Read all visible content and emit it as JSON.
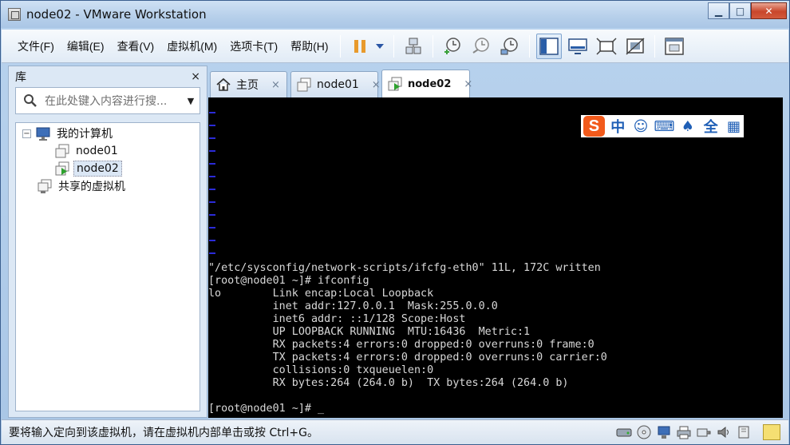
{
  "window": {
    "title": "node02 - VMware Workstation",
    "minimize": "▁",
    "maximize": "□",
    "close": "✕"
  },
  "menu": {
    "items": [
      "文件(F)",
      "编辑(E)",
      "查看(V)",
      "虚拟机(M)",
      "选项卡(T)",
      "帮助(H)"
    ]
  },
  "toolbar": {
    "icons": [
      "pause-icon",
      "dropdown-arrow-icon",
      "send-ctrl-alt-del-icon",
      "snapshot-take-icon",
      "snapshot-revert-icon",
      "snapshot-manager-icon",
      "library-view-icon",
      "console-view-icon",
      "fullscreen-icon",
      "unity-icon",
      "thumbnail-view-icon"
    ]
  },
  "library": {
    "title": "库",
    "close": "×",
    "search_placeholder": "在此处键入内容进行搜...",
    "tree": {
      "root": "我的计算机",
      "children": [
        "node01",
        "node02"
      ],
      "shared": "共享的虚拟机",
      "selected": "node02"
    }
  },
  "tabs": [
    {
      "label": "主页",
      "icon": "home-icon",
      "active": false
    },
    {
      "label": "node01",
      "icon": "vm-icon",
      "active": false
    },
    {
      "label": "node02",
      "icon": "vm-running-icon",
      "active": true
    }
  ],
  "tab_close": "×",
  "ime": {
    "logo": "S",
    "items": [
      "中",
      "☺",
      "⌨",
      "♠",
      "全",
      "▦"
    ]
  },
  "console": {
    "lines": [
      "\"/etc/sysconfig/network-scripts/ifcfg-eth0\" 11L, 172C written",
      "[root@node01 ~]# ifconfig",
      "lo        Link encap:Local Loopback",
      "          inet addr:127.0.0.1  Mask:255.0.0.0",
      "          inet6 addr: ::1/128 Scope:Host",
      "          UP LOOPBACK RUNNING  MTU:16436  Metric:1",
      "          RX packets:4 errors:0 dropped:0 overruns:0 frame:0",
      "          TX packets:4 errors:0 dropped:0 overruns:0 carrier:0",
      "          collisions:0 txqueuelen:0",
      "          RX bytes:264 (264.0 b)  TX bytes:264 (264.0 b)",
      "",
      "[root@node01 ~]# _"
    ]
  },
  "status": {
    "text": "要将输入定向到该虚拟机，请在虚拟机内部单击或按 Ctrl+G。",
    "devices": [
      "hard-disk-icon",
      "cd-rom-icon",
      "network-adapter-icon",
      "printer-icon",
      "usb-controller-icon",
      "sound-card-icon",
      "display-icon"
    ]
  },
  "colors": {
    "title_bar": "#b6cfea",
    "console_bg": "#000000",
    "console_fg": "#d8d8d8",
    "vim_tilde": "#2b2bd8",
    "ime_brand": "#f25a1b",
    "accent": "#1f5fb6"
  }
}
